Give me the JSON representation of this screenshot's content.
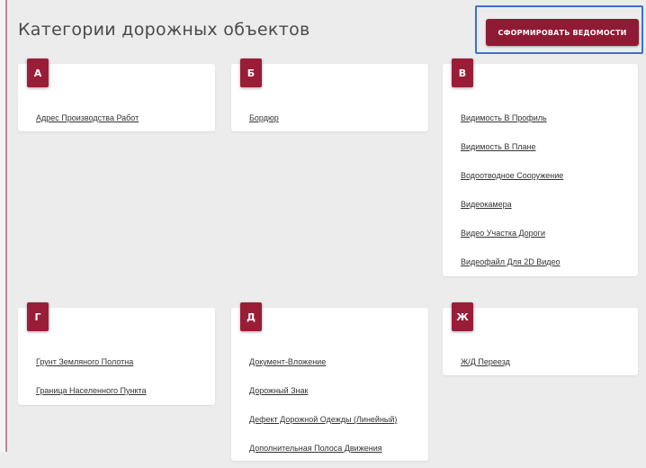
{
  "header": {
    "title": "Категории дорожных объектов",
    "generate_button_label": "СФОРМИРОВАТЬ ВЕДОМОСТИ"
  },
  "colors": {
    "accent": "#8e1a34",
    "focus_outline": "#3b72c4",
    "background": "#ececec"
  },
  "categories": [
    {
      "letter": "А",
      "items": [
        "Адрес Производства Работ"
      ]
    },
    {
      "letter": "Б",
      "items": [
        "Бордюр"
      ]
    },
    {
      "letter": "В",
      "items": [
        "Видимость В Профиль",
        "Видимость В Плане",
        "Водоотводное Сооружение",
        "Видеокамера",
        "Видео Участка Дороги",
        "Видеофайл Для 2D Видео"
      ]
    },
    {
      "letter": "Г",
      "items": [
        "Грунт Земляного Полотна",
        "Граница Населенного Пункта"
      ]
    },
    {
      "letter": "Д",
      "items": [
        "Документ-Вложение",
        "Дорожный Знак",
        "Дефект Дорожной Одежды (Линейный)",
        "Дополнительная Полоса Движения"
      ]
    },
    {
      "letter": "Ж",
      "items": [
        "Ж/Д Переезд"
      ]
    }
  ]
}
